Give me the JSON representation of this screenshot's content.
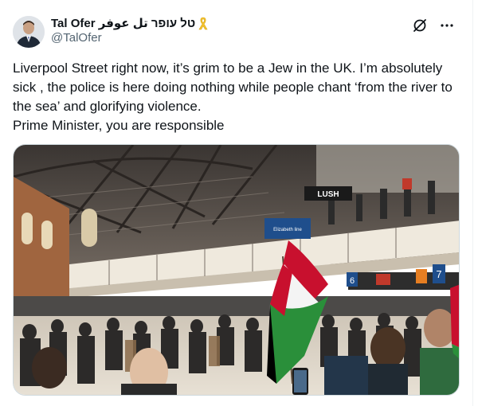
{
  "author": {
    "display_name": "Tal Ofer טל עופר تل عوفر",
    "handle": "@TalOfer",
    "badge_icon": "yellow-ribbon-icon"
  },
  "header_icons": [
    "grok-icon",
    "more-icon"
  ],
  "tweet": {
    "text": "Liverpool Street right now, it’s grim to be a Jew in the UK. I’m absolutely sick , the police is here doing nothing while people chant ‘from the river to the sea’ and glorifying violence.\nPrime Minister, you are responsible"
  },
  "media": {
    "signs": {
      "shop": "LUSH",
      "platform_sign": "Elizabeth line",
      "platform_numbers": [
        "6",
        "7"
      ]
    }
  },
  "colors": {
    "text": "#0f1419",
    "secondary": "#536471",
    "border": "#cfd9de",
    "ribbon": "#f4c430"
  }
}
